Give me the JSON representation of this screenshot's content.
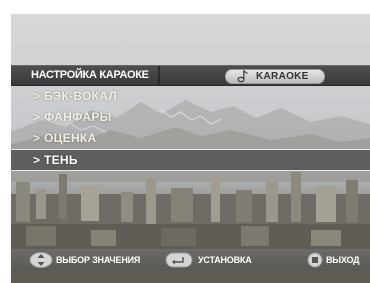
{
  "menu": {
    "title": "НАСТРОЙКА КАРАОКЕ",
    "mode_label": "KARAOKE",
    "mode_icon": "music-note-icon",
    "items": [
      {
        "label": "> БЭК-ВОКАЛ",
        "selected": false
      },
      {
        "label": "> ФАНФАРЫ",
        "selected": false
      },
      {
        "label": "> ОЦЕНКА",
        "selected": false
      },
      {
        "label": "> ТЕНЬ",
        "selected": true
      }
    ]
  },
  "hints": {
    "select_label": "ВЫБОР ЗНАЧЕНИЯ",
    "select_icon": "dpad-up-down-icon",
    "enter_label": "УСТАНОВКА",
    "enter_icon": "enter-button-icon",
    "exit_label": "ВЫХОД",
    "exit_icon": "stop-button-icon"
  },
  "colors": {
    "title_bar": "#3f3f41",
    "selection_border": "#ffffff",
    "text": "#ffffff"
  }
}
